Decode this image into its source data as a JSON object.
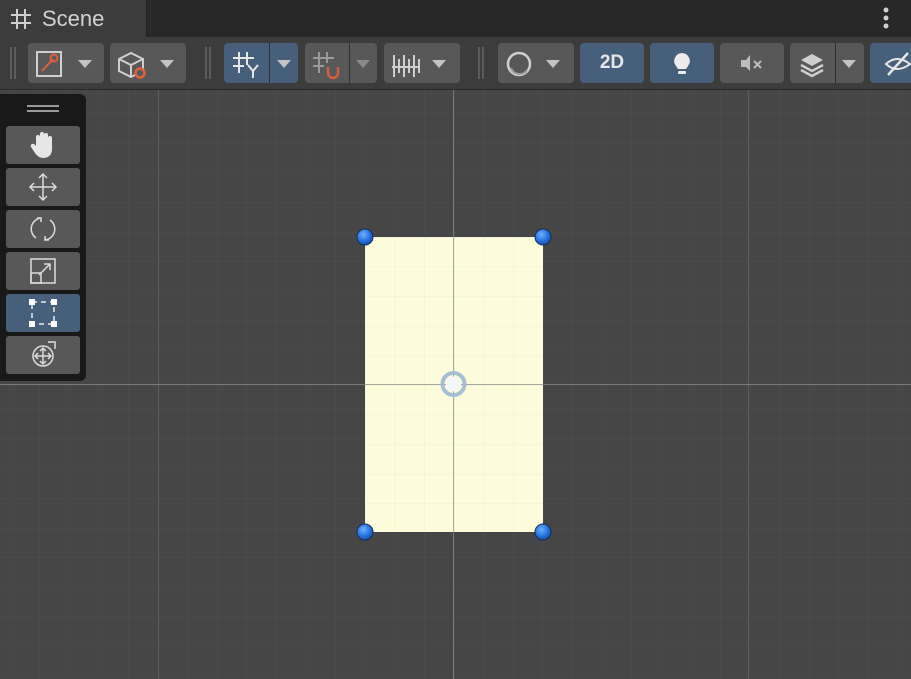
{
  "window": {
    "tab": {
      "title": "Scene",
      "icon": "hash-grid-icon"
    },
    "menu_icon": "kebab-menu-icon"
  },
  "toolbar": {
    "items": [
      {
        "name": "gizmo-draw-mode",
        "icon": "draw-mode-icon"
      },
      {
        "name": "scene-view-object",
        "icon": "cube-icon"
      },
      {
        "name": "grid-visibility",
        "icon": "grid-y-icon",
        "active": true
      },
      {
        "name": "grid-snapping",
        "icon": "snap-magnet-icon"
      },
      {
        "name": "increment-snapping",
        "icon": "ruler-icon"
      },
      {
        "name": "shading-mode",
        "icon": "sphere-icon"
      },
      {
        "name": "2d-mode",
        "label": "2D",
        "active": true
      },
      {
        "name": "lighting",
        "icon": "lightbulb-icon",
        "active": true
      },
      {
        "name": "audio",
        "icon": "speaker-muted-icon"
      },
      {
        "name": "effects",
        "icon": "layers-icon"
      },
      {
        "name": "scene-visibility",
        "icon": "eye-hidden-icon",
        "active": true
      }
    ]
  },
  "tools": [
    {
      "name": "hand-tool",
      "icon": "hand-icon"
    },
    {
      "name": "move-tool",
      "icon": "move-arrows-icon"
    },
    {
      "name": "rotate-tool",
      "icon": "rotate-icon"
    },
    {
      "name": "scale-tool",
      "icon": "scale-icon"
    },
    {
      "name": "rect-tool",
      "icon": "rect-icon",
      "active": true
    },
    {
      "name": "transform-tool",
      "icon": "transform-icon"
    }
  ],
  "colors": {
    "scene_bg": "#464646",
    "sprite_fill": "#fdfddc",
    "handle_blue": "#2478e0",
    "active_button": "#46607c"
  }
}
